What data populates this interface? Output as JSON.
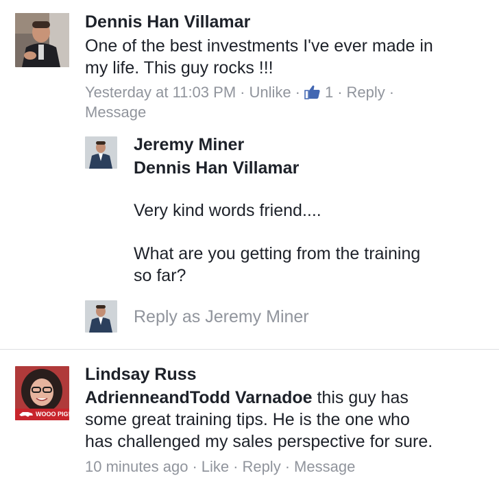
{
  "comments": [
    {
      "author": "Dennis Han Villamar",
      "text_lines": [
        "One of the best investments I've ever made in",
        "my life. This guy rocks !!!"
      ],
      "meta": {
        "time": "Yesterday at 11:03 PM",
        "unlike": "Unlike",
        "like_count": "1",
        "reply": "Reply",
        "message": "Message"
      },
      "reply": {
        "author": "Jeremy Miner",
        "tagged": "Dennis Han Villamar",
        "para1": "Very kind words friend....",
        "para2_lines": [
          "What are you getting from the training",
          "so far?"
        ]
      },
      "reply_box_placeholder": "Reply as Jeremy Miner"
    },
    {
      "author": "Lindsay Russ",
      "avatar_badge": "WOOO PIG!",
      "tagged": "AdrienneandTodd Varnadoe",
      "text_line1_rest": " this guy has",
      "text_lines": [
        "some great training tips. He is the one who",
        "has challenged my sales perspective for sure."
      ],
      "meta": {
        "time": "10 minutes ago",
        "like": "Like",
        "reply": "Reply",
        "message": "Message"
      }
    }
  ],
  "colors": {
    "text": "#1d2129",
    "meta": "#90949c",
    "like_blue": "#4267b2",
    "divider": "#dddfe2"
  }
}
